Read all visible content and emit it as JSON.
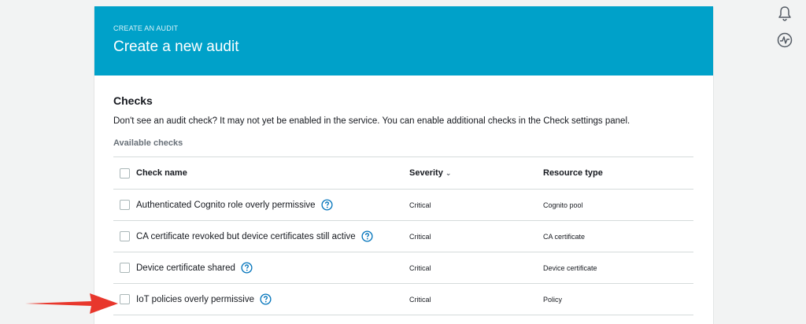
{
  "side_icons": [
    "bell-icon",
    "activity-icon"
  ],
  "header": {
    "eyebrow": "CREATE AN AUDIT",
    "title": "Create a new audit"
  },
  "checks": {
    "title": "Checks",
    "description": "Don't see an audit check? It may not yet be enabled in the service. You can enable additional checks in the Check settings panel.",
    "available_label": "Available checks"
  },
  "table": {
    "columns": {
      "name": "Check name",
      "severity": "Severity",
      "resource": "Resource type"
    },
    "rows": [
      {
        "name": "Authenticated Cognito role overly permissive",
        "severity": "Critical",
        "resource": "Cognito pool"
      },
      {
        "name": "CA certificate revoked but device certificates still active",
        "severity": "Critical",
        "resource": "CA certificate"
      },
      {
        "name": "Device certificate shared",
        "severity": "Critical",
        "resource": "Device certificate"
      },
      {
        "name": "IoT policies overly permissive",
        "severity": "Critical",
        "resource": "Policy"
      }
    ]
  },
  "colors": {
    "header_bg": "#00a1c9",
    "help_icon": "#0073bb",
    "arrow": "#e8372c"
  }
}
